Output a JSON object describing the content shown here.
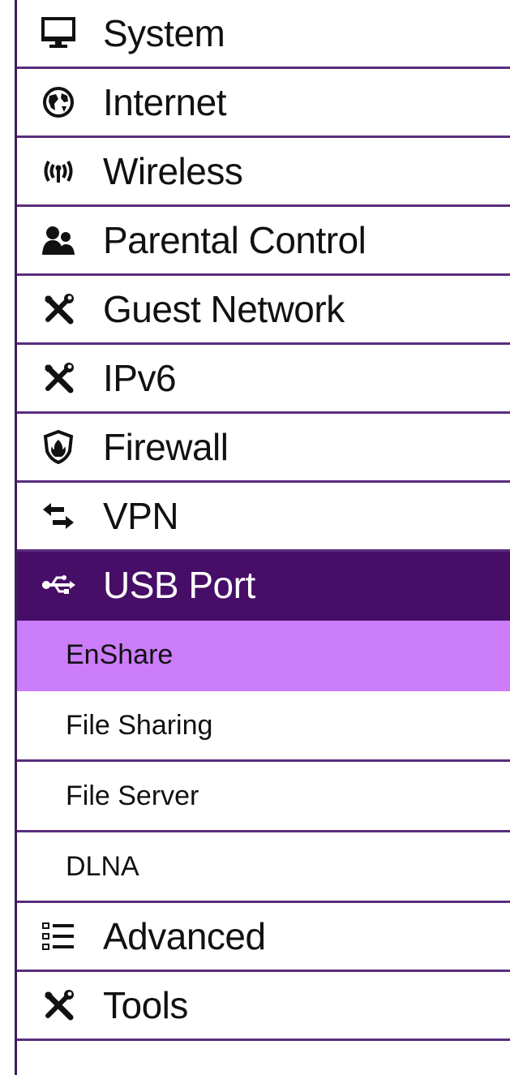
{
  "menu": {
    "items": [
      {
        "label": "System",
        "icon": "monitor-icon"
      },
      {
        "label": "Internet",
        "icon": "globe-icon"
      },
      {
        "label": "Wireless",
        "icon": "wireless-icon"
      },
      {
        "label": "Parental Control",
        "icon": "users-icon"
      },
      {
        "label": "Guest Network",
        "icon": "tools-icon"
      },
      {
        "label": "IPv6",
        "icon": "tools-icon"
      },
      {
        "label": "Firewall",
        "icon": "shield-icon"
      },
      {
        "label": "VPN",
        "icon": "arrows-icon"
      },
      {
        "label": "USB Port",
        "icon": "usb-icon",
        "active": true
      }
    ],
    "usb_submenu": [
      {
        "label": "EnShare",
        "selected": true
      },
      {
        "label": "File Sharing"
      },
      {
        "label": "File Server"
      },
      {
        "label": "DLNA"
      }
    ],
    "bottom_items": [
      {
        "label": "Advanced",
        "icon": "list-icon"
      },
      {
        "label": "Tools",
        "icon": "tools-icon"
      }
    ]
  },
  "colors": {
    "active_bg": "#470e68",
    "selected_sub_bg": "#cc7dfa",
    "divider": "#5a2d7d"
  }
}
